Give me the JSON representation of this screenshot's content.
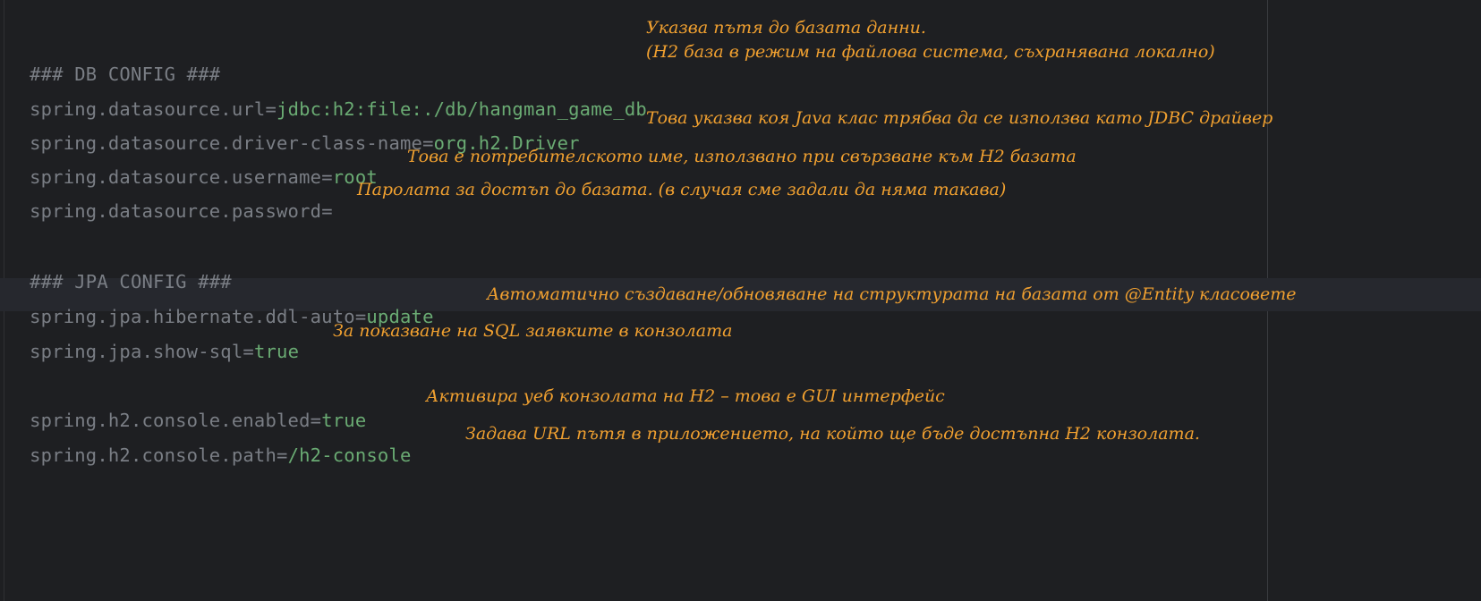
{
  "editor": {
    "lines": [
      {
        "type": "comment",
        "text": "### DB CONFIG ###"
      },
      {
        "type": "property",
        "key": "spring.datasource.url",
        "value": "jdbc:h2:file:./db/hangman_game_db"
      },
      {
        "type": "property",
        "key": "spring.datasource.driver-class-name",
        "value": "org.h2.Driver"
      },
      {
        "type": "property",
        "key": "spring.datasource.username",
        "value": "root"
      },
      {
        "type": "property",
        "key": "spring.datasource.password",
        "value": ""
      },
      {
        "type": "comment",
        "text": "### JPA CONFIG ###"
      },
      {
        "type": "property",
        "key": "spring.jpa.hibernate.ddl-auto",
        "value": "update"
      },
      {
        "type": "property",
        "key": "spring.jpa.show-sql",
        "value": "true"
      },
      {
        "type": "property",
        "key": "spring.h2.console.enabled",
        "value": "true"
      },
      {
        "type": "property",
        "key": "spring.h2.console.path",
        "value": "/h2-console"
      }
    ],
    "equals": "="
  },
  "annotations": {
    "url_line1": "Указва пътя до базата данни.",
    "url_line2": "(H2 база в режим на файлова система, съхранявана локално)",
    "driver": "Това указва коя Java клас трябва да се използва като JDBC драйвер",
    "username": "Това е потребителското име, използвано при свързване към H2 базата",
    "password": "Паролата за достъп до базата. (в случая сме задали да няма такава)",
    "ddl_auto": "Автоматично създаване/обновяване на структурата на базата от @Entity класовете",
    "show_sql": "За показване на SQL заявките в конзолата",
    "console_enabled": "Активира уеб конзолата на H2 – това е GUI интерфейс",
    "console_path": "Задава URL пътя в приложението, на който ще бъде достъпна H2 конзолата."
  },
  "colors": {
    "background": "#1e1f22",
    "comment": "#7a7e85",
    "key": "#7a7e85",
    "value": "#6aab73",
    "annotation": "#f0a030",
    "highlight_row": "#26282e"
  }
}
